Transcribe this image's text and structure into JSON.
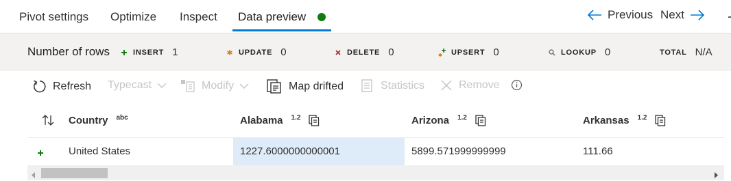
{
  "tabs": [
    {
      "label": "Pivot settings"
    },
    {
      "label": "Optimize"
    },
    {
      "label": "Inspect"
    },
    {
      "label": "Data preview"
    }
  ],
  "active_tab": "Data preview",
  "colors": {
    "accent": "#0078d4",
    "status_dot": "#107c10",
    "insert": "#107c10",
    "update": "#d47500",
    "delete": "#a4262c",
    "selected_cell": "#deecf9"
  },
  "nav": {
    "previous": "Previous",
    "next": "Next"
  },
  "counts": {
    "title": "Number of rows",
    "items": [
      {
        "icon": "plus-icon",
        "label": "INSERT",
        "value": "1"
      },
      {
        "icon": "asterisk-icon",
        "label": "UPDATE",
        "value": "0"
      },
      {
        "icon": "x-icon",
        "label": "DELETE",
        "value": "0"
      },
      {
        "icon": "upsert-icon",
        "label": "UPSERT",
        "value": "0"
      },
      {
        "icon": "magnifier-icon",
        "label": "LOOKUP",
        "value": "0"
      },
      {
        "icon": "",
        "label": "TOTAL",
        "value": "N/A"
      }
    ]
  },
  "toolbar": {
    "refresh": "Refresh",
    "typecast": "Typecast",
    "modify": "Modify",
    "map_drifted": "Map drifted",
    "statistics": "Statistics",
    "remove": "Remove"
  },
  "grid": {
    "columns": [
      {
        "name": "Country",
        "type": "abc"
      },
      {
        "name": "Alabama",
        "type": "1.2"
      },
      {
        "name": "Arizona",
        "type": "1.2"
      },
      {
        "name": "Arkansas",
        "type": "1.2"
      }
    ],
    "rows": [
      {
        "action": "insert",
        "cells": [
          "United States",
          "1227.6000000000001",
          "5899.571999999999",
          "111.66"
        ]
      }
    ]
  }
}
